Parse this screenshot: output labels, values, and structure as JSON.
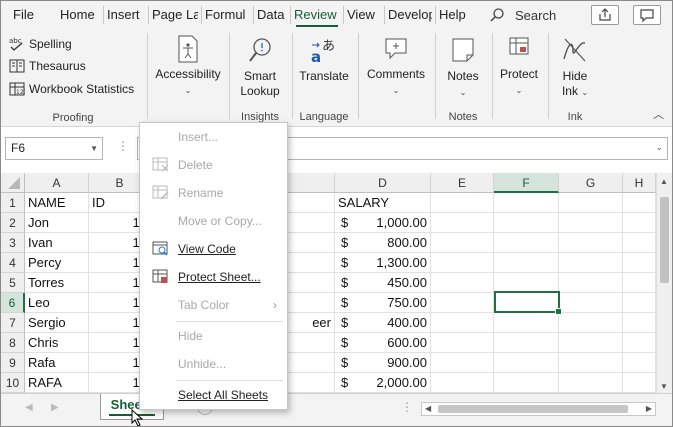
{
  "tabs": [
    "File",
    "Home",
    "Insert",
    "Page La",
    "Formul",
    "Data",
    "Review",
    "View",
    "Develop",
    "Help"
  ],
  "active_tab": "Review",
  "search_label": "Search",
  "ribbon": {
    "proofing": {
      "spelling": "Spelling",
      "thesaurus": "Thesaurus",
      "workbook_statistics": "Workbook Statistics",
      "label": "Proofing"
    },
    "accessibility": {
      "label": "Accessibility"
    },
    "insights": {
      "smart": "Smart",
      "lookup": "Lookup",
      "label": "Insights"
    },
    "language": {
      "translate": "Translate",
      "label": "Language"
    },
    "comments": {
      "label": "Comments"
    },
    "notes": {
      "button": "Notes",
      "label": "Notes"
    },
    "protect": {
      "button": "Protect"
    },
    "ink": {
      "hide": "Hide",
      "ink": "Ink",
      "label": "Ink"
    }
  },
  "name_box": "F6",
  "columns": [
    "A",
    "B",
    "C",
    "D",
    "E",
    "F",
    "G",
    "H"
  ],
  "selected_column": "F",
  "rows": [
    {
      "n": "1",
      "a": "NAME",
      "b": "ID",
      "c": "",
      "d_cur": "",
      "d_val": "SALARY"
    },
    {
      "n": "2",
      "a": "Jon",
      "b": "10",
      "c": "",
      "d_cur": "$",
      "d_val": "1,000.00"
    },
    {
      "n": "3",
      "a": "Ivan",
      "b": "10",
      "c": "",
      "d_cur": "$",
      "d_val": "800.00"
    },
    {
      "n": "4",
      "a": "Percy",
      "b": "10",
      "c": "",
      "d_cur": "$",
      "d_val": "1,300.00"
    },
    {
      "n": "5",
      "a": "Torres",
      "b": "10",
      "c": "",
      "d_cur": "$",
      "d_val": "450.00"
    },
    {
      "n": "6",
      "a": "Leo",
      "b": "10",
      "c": "",
      "d_cur": "$",
      "d_val": "750.00"
    },
    {
      "n": "7",
      "a": "Sergio",
      "b": "10",
      "c": "eer",
      "d_cur": "$",
      "d_val": "400.00"
    },
    {
      "n": "8",
      "a": "Chris",
      "b": "10",
      "c": "",
      "d_cur": "$",
      "d_val": "600.00"
    },
    {
      "n": "9",
      "a": "Rafa",
      "b": "10",
      "c": "",
      "d_cur": "$",
      "d_val": "900.00"
    },
    {
      "n": "10",
      "a": "RAFA",
      "b": "10",
      "c": "",
      "d_cur": "$",
      "d_val": "2,000.00"
    }
  ],
  "selected_row": "6",
  "sheet_tab": "Sheet1",
  "context_menu": [
    {
      "label": "Insert...",
      "disabled": true
    },
    {
      "label": "Delete",
      "disabled": true
    },
    {
      "label": "Rename",
      "disabled": true
    },
    {
      "label": "Move or Copy...",
      "disabled": true
    },
    {
      "label": "View Code",
      "disabled": false
    },
    {
      "label": "Protect Sheet...",
      "disabled": false
    },
    {
      "label": "Tab Color",
      "disabled": true
    },
    {
      "label": "Hide",
      "disabled": true
    },
    {
      "label": "Unhide...",
      "disabled": true
    },
    {
      "label": "Select All Sheets",
      "disabled": false
    }
  ],
  "colors": {
    "accent": "#185c37",
    "grid_select": "#1e7145"
  }
}
